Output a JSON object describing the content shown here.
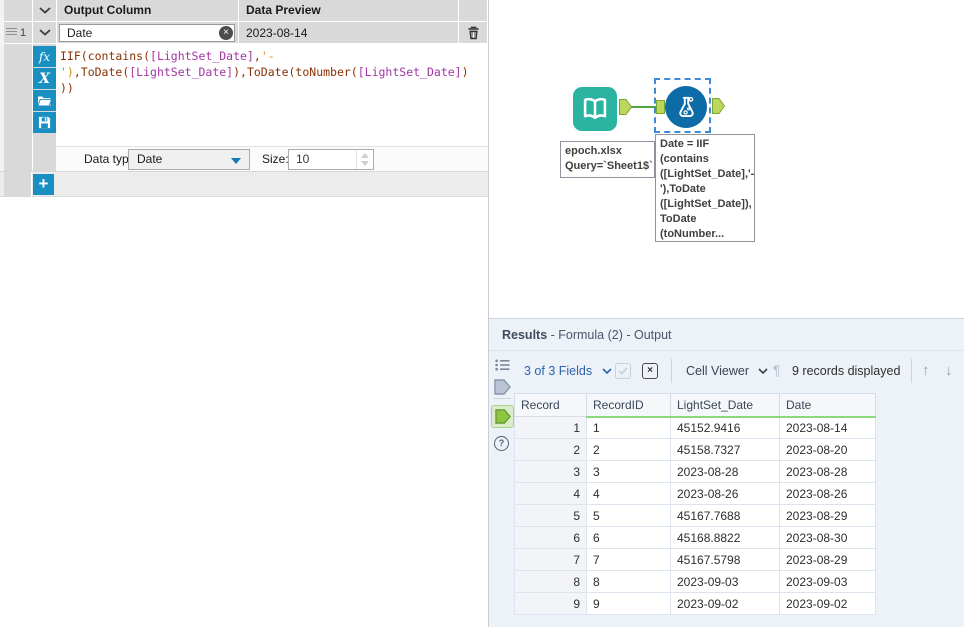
{
  "config_panel": {
    "columns": {
      "output": "Output Column",
      "preview": "Data Preview"
    },
    "row": {
      "number": "1",
      "name": "Date",
      "preview": "2023-08-14",
      "clear_glyph": "×"
    },
    "expression": [
      [
        {
          "t": "IIF(contains(",
          "c": "fn"
        },
        {
          "t": "[LightSet_Date]",
          "c": "field"
        },
        {
          "t": ",",
          "c": "fn"
        },
        {
          "t": "'-",
          "c": "str"
        }
      ],
      [
        {
          "t": "')",
          "c": "str"
        },
        {
          "t": ",ToDate(",
          "c": "fn"
        },
        {
          "t": "[LightSet_Date]",
          "c": "field"
        },
        {
          "t": "),ToDate(toNumber(",
          "c": "fn"
        },
        {
          "t": "[LightSet_Date]",
          "c": "field"
        },
        {
          "t": ")",
          "c": "fn"
        }
      ],
      [
        {
          "t": "))",
          "c": "fn"
        }
      ]
    ],
    "side_buttons": {
      "functions": "fx",
      "variables": "X"
    },
    "data_type": {
      "label": "Data type:",
      "value": "Date"
    },
    "size": {
      "label": "Size:",
      "value": "10"
    },
    "add_label": "+"
  },
  "canvas": {
    "input_tool": {
      "annotation": [
        "epoch.xlsx",
        "Query=`Sheet1$`"
      ]
    },
    "formula_tool": {
      "annotation": [
        "Date = IIF",
        "(contains",
        "([LightSet_Date],'-",
        "'),ToDate",
        "([LightSet_Date]),",
        "ToDate",
        "(toNumber..."
      ]
    }
  },
  "results": {
    "title_bold": "Results",
    "title_rest": " - Formula (2) - Output",
    "toolbar": {
      "fields": "3 of 3 Fields",
      "cell_viewer": "Cell Viewer",
      "records": "9 records displayed",
      "pilcrow": "¶",
      "up_glyph": "↑",
      "down_glyph": "↓",
      "uncheck_glyph": "×",
      "help_glyph": "?"
    },
    "table": {
      "headers": [
        "Record",
        "RecordID",
        "LightSet_Date",
        "Date"
      ],
      "rows": [
        [
          "1",
          "1",
          "45152.9416",
          "2023-08-14"
        ],
        [
          "2",
          "2",
          "45158.7327",
          "2023-08-20"
        ],
        [
          "3",
          "3",
          "2023-08-28",
          "2023-08-28"
        ],
        [
          "4",
          "4",
          "2023-08-26",
          "2023-08-26"
        ],
        [
          "5",
          "5",
          "45167.7688",
          "2023-08-29"
        ],
        [
          "6",
          "6",
          "45168.8822",
          "2023-08-30"
        ],
        [
          "7",
          "7",
          "45167.5798",
          "2023-08-29"
        ],
        [
          "8",
          "8",
          "2023-09-03",
          "2023-09-03"
        ],
        [
          "9",
          "9",
          "2023-09-02",
          "2023-09-02"
        ]
      ]
    }
  },
  "colors": {
    "tool_button_blue": "#1a8fc1",
    "input_tool_teal": "#2ab3a1",
    "formula_tool_blue": "#0d6ba8",
    "anchor_green": "#bcd85a",
    "active_anchor_green": "#8fc641",
    "connection_green": "#55a244",
    "selection_blue": "#3f8ad8",
    "link_blue": "#2a63ad",
    "header_underline_green": "#8cd87c",
    "syntax_function": "#8b3103",
    "syntax_field": "#a435a4",
    "syntax_string": "#e0861a"
  }
}
